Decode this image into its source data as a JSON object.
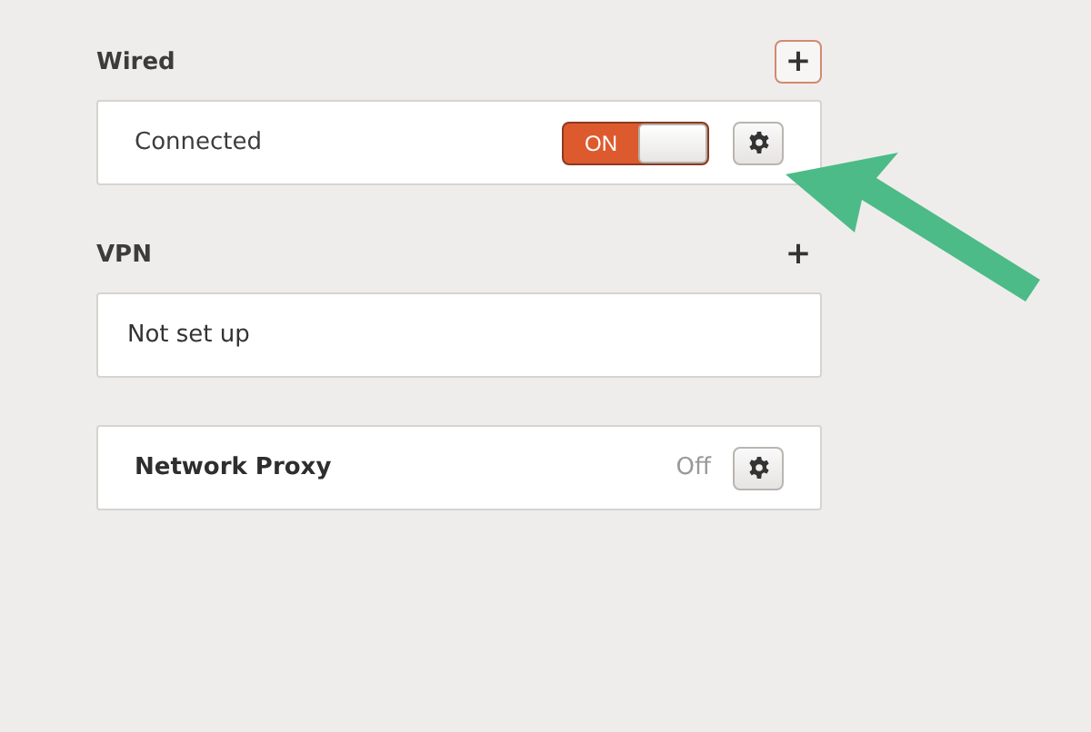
{
  "sections": [
    {
      "title": "Wired",
      "add_button": {
        "label": "+",
        "focused": true
      },
      "rows": [
        {
          "kind": "connection",
          "label": "Connected",
          "toggle": {
            "label": "ON",
            "on": true
          }
        }
      ]
    },
    {
      "title": "VPN",
      "add_button": {
        "label": "+",
        "focused": false
      },
      "rows": [
        {
          "kind": "empty",
          "label": "Not set up"
        }
      ]
    },
    {
      "rows": [
        {
          "kind": "proxy",
          "label": "Network Proxy",
          "status": "Off"
        }
      ]
    }
  ]
}
